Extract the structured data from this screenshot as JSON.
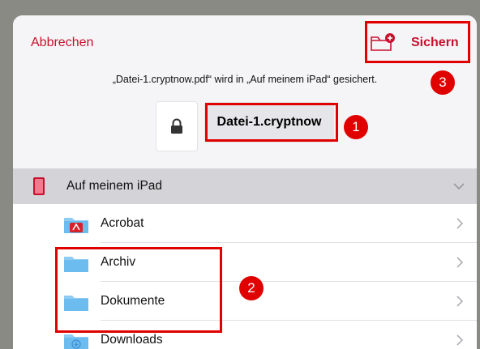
{
  "header": {
    "cancel_label": "Abbrechen",
    "save_label": "Sichern",
    "save_note": "„Datei-1.cryptnow.pdf“ wird in „Auf meinem iPad“ gesichert."
  },
  "file": {
    "name": "Datei-1.cryptnow"
  },
  "location": {
    "label": "Auf meinem iPad",
    "folders": [
      {
        "label": "Acrobat",
        "icon": "acrobat-icon"
      },
      {
        "label": "Archiv",
        "icon": "folder-icon"
      },
      {
        "label": "Dokumente",
        "icon": "folder-icon"
      },
      {
        "label": "Downloads",
        "icon": "downloads-folder-icon"
      }
    ]
  },
  "annotations": {
    "n1": "1",
    "n2": "2",
    "n3": "3"
  },
  "colors": {
    "accent": "#c8102e",
    "annotation": "#e00000",
    "folder": "#6dbcf0"
  }
}
